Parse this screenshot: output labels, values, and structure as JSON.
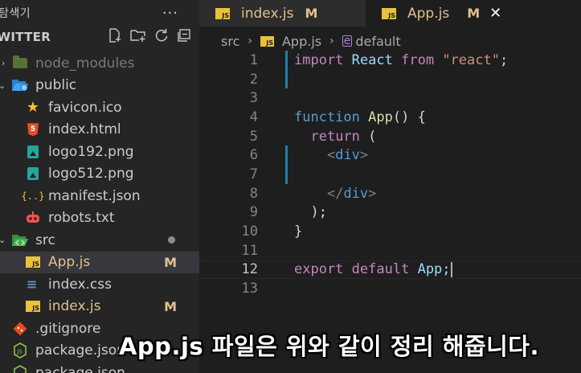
{
  "sidebar": {
    "header_title": "탐색기",
    "header_more": "···",
    "project_name": "TWITTER",
    "actions": [
      "new-file-icon",
      "new-folder-icon",
      "refresh-icon",
      "collapse-icon"
    ],
    "items": [
      {
        "label": "node_modules",
        "icon": "folder-icon",
        "depth": 0,
        "state": "dim"
      },
      {
        "label": "public",
        "icon": "folder-open-icon",
        "depth": 0,
        "state": "normal"
      },
      {
        "label": "favicon.ico",
        "icon": "star-icon",
        "depth": 1,
        "state": "normal"
      },
      {
        "label": "index.html",
        "icon": "html-file-icon",
        "depth": 1,
        "state": "normal"
      },
      {
        "label": "logo192.png",
        "icon": "image-file-icon",
        "depth": 1,
        "state": "normal"
      },
      {
        "label": "logo512.png",
        "icon": "image-file-icon",
        "depth": 1,
        "state": "normal"
      },
      {
        "label": "manifest.json",
        "icon": "json-file-icon",
        "depth": 1,
        "state": "normal"
      },
      {
        "label": "robots.txt",
        "icon": "robot-icon",
        "depth": 1,
        "state": "normal"
      },
      {
        "label": "src",
        "icon": "folder-open-icon",
        "depth": 0,
        "state": "normal"
      },
      {
        "label": "App.js",
        "icon": "js-file-icon",
        "depth": 1,
        "state": "modified",
        "badge": "M"
      },
      {
        "label": "index.css",
        "icon": "css-file-icon",
        "depth": 1,
        "state": "normal"
      },
      {
        "label": "index.js",
        "icon": "js-file-icon",
        "depth": 1,
        "state": "modified",
        "badge": "M"
      },
      {
        "label": ".gitignore",
        "icon": "git-icon",
        "depth": 0,
        "state": "normal"
      },
      {
        "label": "package.json",
        "icon": "node-icon",
        "depth": 0,
        "state": "normal"
      },
      {
        "label": "package.json",
        "icon": "node-icon",
        "depth": 0,
        "state": "normal"
      }
    ]
  },
  "tabs": [
    {
      "label": "index.js",
      "mark": "M",
      "active": false
    },
    {
      "label": "App.js",
      "mark": "M",
      "active": true,
      "close": "✕"
    }
  ],
  "breadcrumb": {
    "folder": "src",
    "file": "App.js",
    "symbol": "default"
  },
  "code": {
    "current_line": 12,
    "lines": [
      {
        "n": "1"
      },
      {
        "n": "2"
      },
      {
        "n": "3"
      },
      {
        "n": "4"
      },
      {
        "n": "5"
      },
      {
        "n": "6"
      },
      {
        "n": "7"
      },
      {
        "n": "8"
      },
      {
        "n": "9"
      },
      {
        "n": "10"
      },
      {
        "n": "11"
      },
      {
        "n": "12"
      },
      {
        "n": "13"
      }
    ],
    "tokens": {
      "import": "import",
      "React": "React",
      "from": "from",
      "react_str": "\"react\"",
      "semi": ";",
      "function": "function",
      "App": "App",
      "parens": "()",
      "brace_open": "{",
      "return": "return",
      "paren_open": "(",
      "div_open": "<div>",
      "div_close": "</div>",
      "paren_close_semi": ");",
      "brace_close": "}",
      "export": "export",
      "default": "default",
      "app_semi": "App;"
    }
  },
  "caption": "App.js 파일은 위와 같이 정리 해줍니다.",
  "colors": {
    "modified": "#e2c08d",
    "keyword_purple": "#c586c0",
    "keyword_blue": "#569cd6",
    "string": "#ce9178",
    "function": "#dcdcaa",
    "variable": "#9cdcfe",
    "gutter_change": "#1b81a8"
  }
}
